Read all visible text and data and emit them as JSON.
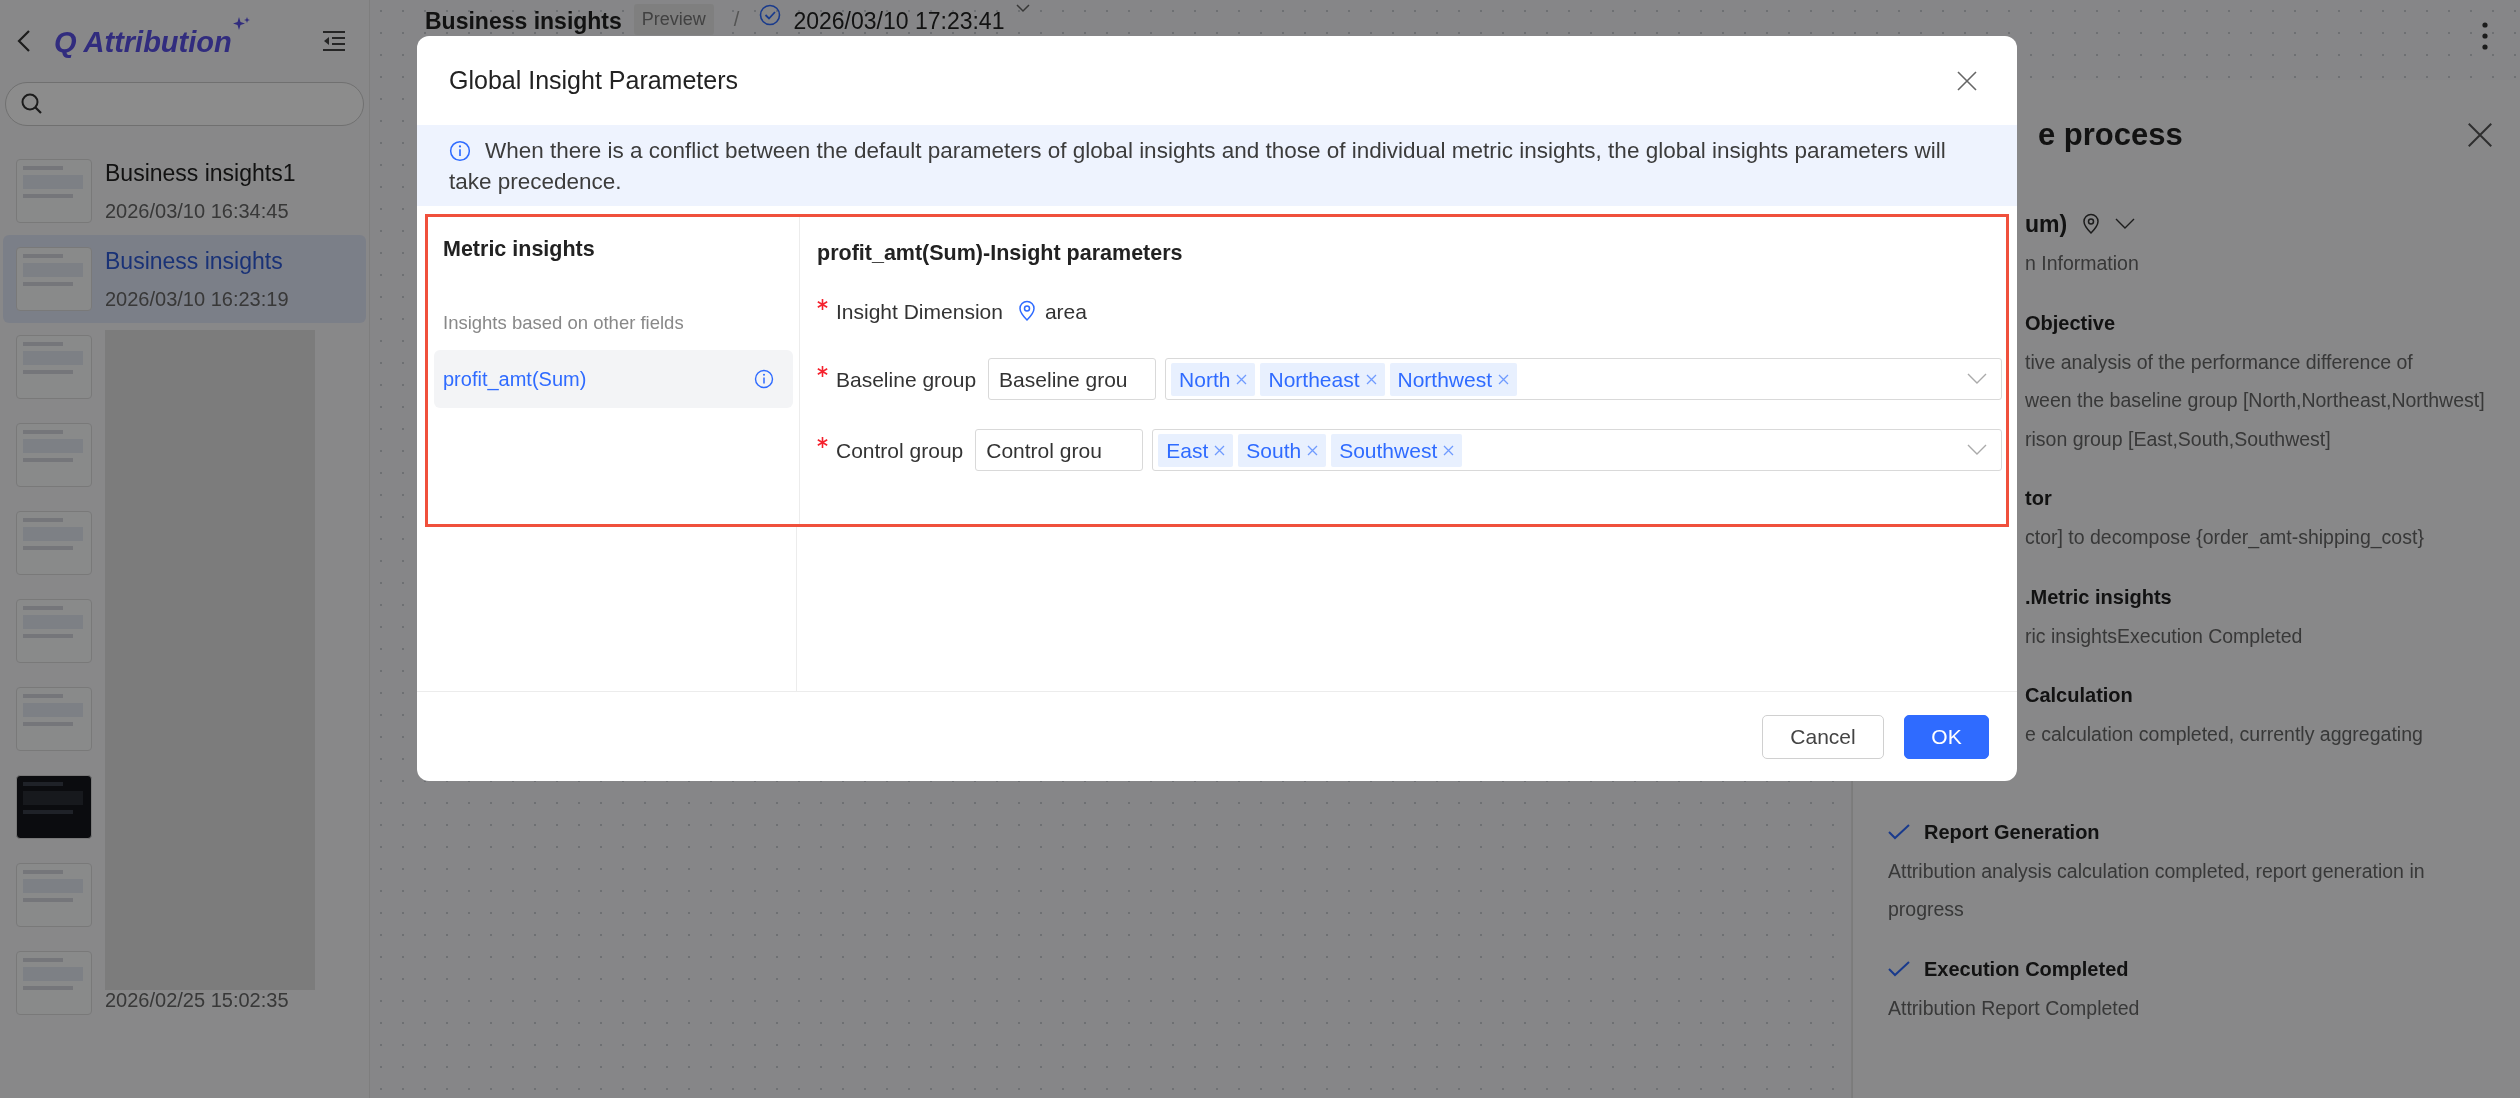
{
  "sidebar": {
    "logo": "Q Attribution",
    "items": [
      {
        "title": "Business insights1",
        "date": "2026/03/10 16:34:45",
        "selected": false,
        "kind": "light"
      },
      {
        "title": "Business insights",
        "date": "2026/03/10 16:23:19",
        "selected": true,
        "kind": "light"
      },
      {
        "selected": false,
        "kind": "light"
      },
      {
        "selected": false,
        "kind": "light"
      },
      {
        "selected": false,
        "kind": "light"
      },
      {
        "selected": false,
        "kind": "light"
      },
      {
        "selected": false,
        "kind": "light"
      },
      {
        "selected": false,
        "kind": "dark"
      },
      {
        "selected": false,
        "kind": "light"
      },
      {
        "date": "2026/02/25 15:02:35",
        "selected": false,
        "kind": "light"
      }
    ]
  },
  "header": {
    "title": "Business insights",
    "badge": "Preview",
    "separator": "/",
    "version": "2026/03/10 17:23:41"
  },
  "right_panel": {
    "title": "e process",
    "sections": [
      {
        "kind": "clipped",
        "heading": "um)",
        "lines": [
          "n Information"
        ],
        "icons": true
      },
      {
        "kind": "clipped",
        "heading": "Objective",
        "lines": [
          "tive analysis of the performance difference of",
          "ween the baseline group [North,Northeast,Northwest]",
          "rison group [East,South,Southwest]"
        ]
      },
      {
        "kind": "clipped",
        "heading": "tor",
        "lines": [
          "ctor] to decompose {order_amt-shipping_cost}"
        ]
      },
      {
        "kind": "clipped",
        "heading": ".Metric insights",
        "lines": [
          "ric insightsExecution Completed"
        ]
      },
      {
        "kind": "clipped",
        "heading": "Calculation",
        "lines": [
          "e calculation completed, currently aggregating"
        ]
      },
      {
        "kind": "step",
        "heading": "Report Generation",
        "lines": [
          "Attribution analysis calculation completed, report generation in progress"
        ]
      },
      {
        "kind": "step",
        "heading": "Execution Completed",
        "lines": [
          "Attribution Report Completed"
        ]
      }
    ]
  },
  "dialog": {
    "title": "Global Insight Parameters",
    "notice": "When there is a conflict between the default parameters of global insights and those of individual metric insights, the global insights parameters will take precedence.",
    "left": {
      "title": "Metric insights",
      "subtitle": "Insights based on other fields",
      "items": [
        {
          "label": "profit_amt(Sum)",
          "selected": true
        }
      ]
    },
    "right": {
      "title": "profit_amt(Sum)-Insight parameters",
      "dimension": {
        "label": "Insight Dimension",
        "required": true,
        "value": "area"
      },
      "groups": [
        {
          "label": "Baseline group",
          "required": true,
          "value": "Baseline grou",
          "tags": [
            "North",
            "Northeast",
            "Northwest"
          ]
        },
        {
          "label": "Control group",
          "required": true,
          "value": "Control grou",
          "tags": [
            "East",
            "South",
            "Southwest"
          ]
        }
      ]
    },
    "buttons": [
      {
        "label": "Cancel",
        "kind": "secondary"
      },
      {
        "label": "OK",
        "kind": "primary"
      }
    ]
  }
}
